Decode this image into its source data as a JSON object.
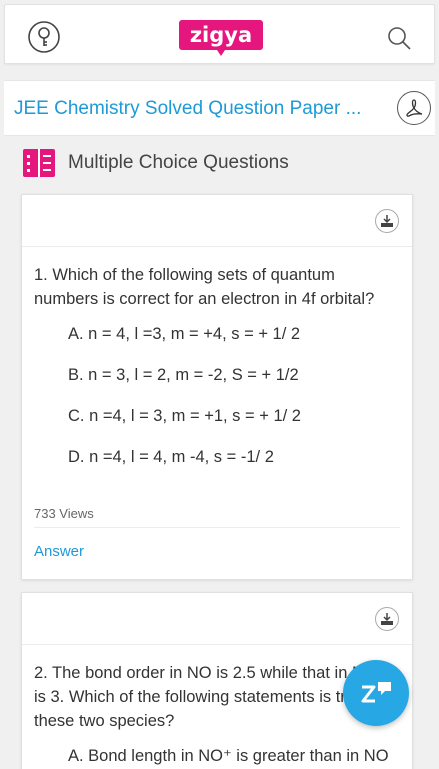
{
  "header": {
    "logo_text": "zigya"
  },
  "titlebar": {
    "title": "JEE Chemistry Solved Question Paper ..."
  },
  "section": {
    "title": "Multiple Choice Questions"
  },
  "questions": [
    {
      "text": "1.  Which of the following sets of quantum numbers is correct for an electron in 4f orbital?",
      "options": [
        "A. n = 4, l =3, m = +4, s = + 1/ 2",
        "B. n = 3, l = 2, m = -2, S = + 1/2",
        "C. n =4, l = 3, m = +1, s = + 1/ 2",
        "D. n =4, l = 4, m -4, s = -1/ 2"
      ],
      "views": "733 Views",
      "answer_label": "Answer"
    },
    {
      "text": "2.  The bond order in NO is 2.5 while that in NO⁺ is 3. Which of the following statements is true for these two species?",
      "options": [
        "A. Bond length in NO⁺ is greater than in NO"
      ]
    }
  ],
  "colors": {
    "accent": "#1e9ad6",
    "brand_pink": "#e5177e",
    "fab": "#27a7e3"
  },
  "icons": {
    "left": "key-help-icon",
    "search": "search-icon",
    "pdf": "pdf-icon",
    "section": "book-list-icon",
    "download": "download-icon",
    "fab": "zigya-chat-icon"
  }
}
